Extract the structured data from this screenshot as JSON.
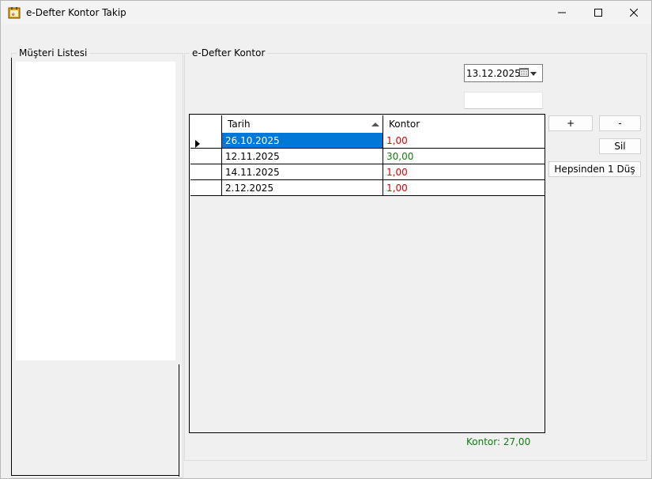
{
  "window": {
    "title": "e-Defter Kontor Takip"
  },
  "customer_panel": {
    "label": "Müşteri Listesi",
    "items": []
  },
  "kontor_panel": {
    "label": "e-Defter Kontor",
    "date_value": "13.12.2025",
    "amount_value": "",
    "grid": {
      "columns": [
        "Tarih",
        "Kontor"
      ],
      "sort_column": "Tarih",
      "sort_direction": "ascending",
      "rows": [
        {
          "tarih": "26.10.2025",
          "kontor": "1,00",
          "kontor_color": "#e00000",
          "selected": true
        },
        {
          "tarih": "12.11.2025",
          "kontor": "30,00",
          "kontor_color": "#107c10",
          "selected": false
        },
        {
          "tarih": "14.11.2025",
          "kontor": "1,00",
          "kontor_color": "#e00000",
          "selected": false
        },
        {
          "tarih": "2.12.2025",
          "kontor": "1,00",
          "kontor_color": "#e00000",
          "selected": false
        }
      ]
    },
    "buttons": {
      "add": "+",
      "subtract": "-",
      "delete": "Sil",
      "deduct_all": "Hepsinden 1 Düş"
    },
    "total_label": "Kontor: 27,00",
    "total_color": "#107c10"
  },
  "icons": {
    "app": "ledger-app-icon",
    "minimize": "minimize-icon",
    "maximize": "maximize-icon",
    "close": "close-icon",
    "calendar": "calendar-icon",
    "dropdown": "chevron-down-icon",
    "sort": "sort-ascending-icon",
    "row_pointer": "current-row-icon"
  }
}
